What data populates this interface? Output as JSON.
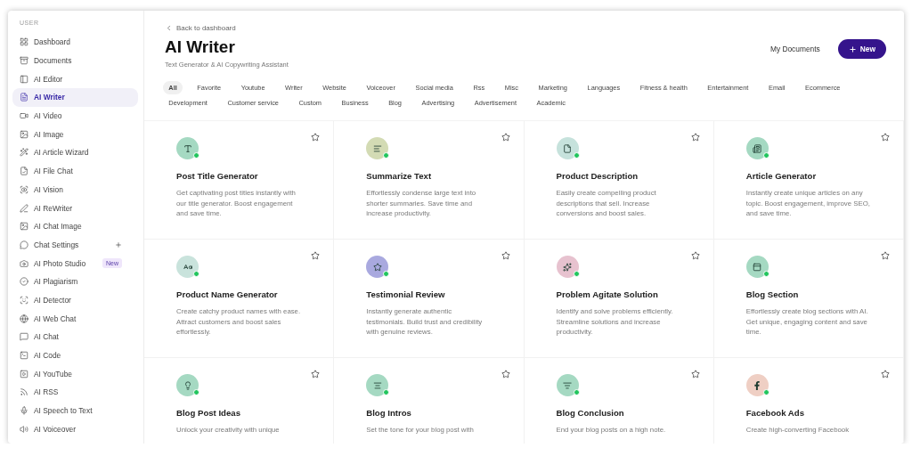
{
  "sidebar": {
    "section_label": "USER",
    "items": [
      {
        "label": "Dashboard",
        "selected": false
      },
      {
        "label": "Documents",
        "selected": false
      },
      {
        "label": "AI Editor",
        "selected": false
      },
      {
        "label": "AI Writer",
        "selected": true
      },
      {
        "label": "AI Video",
        "selected": false
      },
      {
        "label": "AI Image",
        "selected": false
      },
      {
        "label": "AI Article Wizard",
        "selected": false
      },
      {
        "label": "AI File Chat",
        "selected": false
      },
      {
        "label": "AI Vision",
        "selected": false
      },
      {
        "label": "AI ReWriter",
        "selected": false
      },
      {
        "label": "AI Chat Image",
        "selected": false
      },
      {
        "label": "Chat Settings",
        "selected": false,
        "expandable": true
      },
      {
        "label": "AI Photo Studio",
        "selected": false,
        "badge": "New"
      },
      {
        "label": "AI Plagiarism",
        "selected": false
      },
      {
        "label": "AI Detector",
        "selected": false
      },
      {
        "label": "AI Web Chat",
        "selected": false
      },
      {
        "label": "AI Chat",
        "selected": false
      },
      {
        "label": "AI Code",
        "selected": false
      },
      {
        "label": "AI YouTube",
        "selected": false
      },
      {
        "label": "AI RSS",
        "selected": false
      },
      {
        "label": "AI Speech to Text",
        "selected": false
      },
      {
        "label": "AI Voiceover",
        "selected": false
      }
    ]
  },
  "header": {
    "back_link": "Back to dashboard",
    "title": "AI Writer",
    "subtitle": "Text Generator & AI Copywriting Assistant",
    "secondary_button": "My Documents",
    "primary_button": "New"
  },
  "filters": [
    {
      "label": "All",
      "selected": true
    },
    {
      "label": "Favorite",
      "selected": false
    },
    {
      "label": "Youtube",
      "selected": false
    },
    {
      "label": "Writer",
      "selected": false
    },
    {
      "label": "Website",
      "selected": false
    },
    {
      "label": "Voiceover",
      "selected": false
    },
    {
      "label": "Social media",
      "selected": false
    },
    {
      "label": "Rss",
      "selected": false
    },
    {
      "label": "Misc",
      "selected": false
    },
    {
      "label": "Marketing",
      "selected": false
    },
    {
      "label": "Languages",
      "selected": false
    },
    {
      "label": "Fitness & health",
      "selected": false
    },
    {
      "label": "Entertainment",
      "selected": false
    },
    {
      "label": "Email",
      "selected": false
    },
    {
      "label": "Ecommerce",
      "selected": false
    },
    {
      "label": "Development",
      "selected": false
    },
    {
      "label": "Customer service",
      "selected": false
    },
    {
      "label": "Custom",
      "selected": false
    },
    {
      "label": "Business",
      "selected": false
    },
    {
      "label": "Blog",
      "selected": false
    },
    {
      "label": "Advertising",
      "selected": false
    },
    {
      "label": "Advertisement",
      "selected": false
    },
    {
      "label": "Academic",
      "selected": false
    }
  ],
  "tools": [
    {
      "title": "Post Title Generator",
      "description": "Get captivating post titles instantly with our title generator. Boost engagement and save time.",
      "color": "#a5d9c2",
      "favorite": false
    },
    {
      "title": "Summarize Text",
      "description": "Effortlessly condense large text into shorter summaries. Save time and increase productivity.",
      "color": "#d3dbb4",
      "favorite": false
    },
    {
      "title": "Product Description",
      "description": "Easily create compelling product descriptions that sell. Increase conversions and boost sales.",
      "color": "#c6e2dc",
      "favorite": false
    },
    {
      "title": "Article Generator",
      "description": "Instantly create unique articles on any topic. Boost engagement, improve SEO, and save time.",
      "color": "#a5d9c2",
      "favorite": false
    },
    {
      "title": "Product Name Generator",
      "description": "Create catchy product names with ease. Attract customers and boost sales effortlessly.",
      "color": "#c9e3dc",
      "favorite": false
    },
    {
      "title": "Testimonial Review",
      "description": "Instantly generate authentic testimonials. Build trust and credibility with genuine reviews.",
      "color": "#a9a9df",
      "favorite": false
    },
    {
      "title": "Problem Agitate Solution",
      "description": "Identify and solve problems efficiently. Streamline solutions and increase productivity.",
      "color": "#e7c2cf",
      "favorite": false
    },
    {
      "title": "Blog Section",
      "description": "Effortlessly create blog sections with AI. Get unique, engaging content and save time.",
      "color": "#a5d9c2",
      "favorite": false
    },
    {
      "title": "Blog Post Ideas",
      "description": "Unlock your creativity with unique",
      "color": "#a5d9c2",
      "favorite": false
    },
    {
      "title": "Blog Intros",
      "description": "Set the tone for your blog post with",
      "color": "#a5d9c2",
      "favorite": false
    },
    {
      "title": "Blog Conclusion",
      "description": "End your blog posts on a high note.",
      "color": "#a5d9c2",
      "favorite": false
    },
    {
      "title": "Facebook Ads",
      "description": "Create high-converting Facebook",
      "color": "#efcfc4",
      "favorite": false
    }
  ]
}
